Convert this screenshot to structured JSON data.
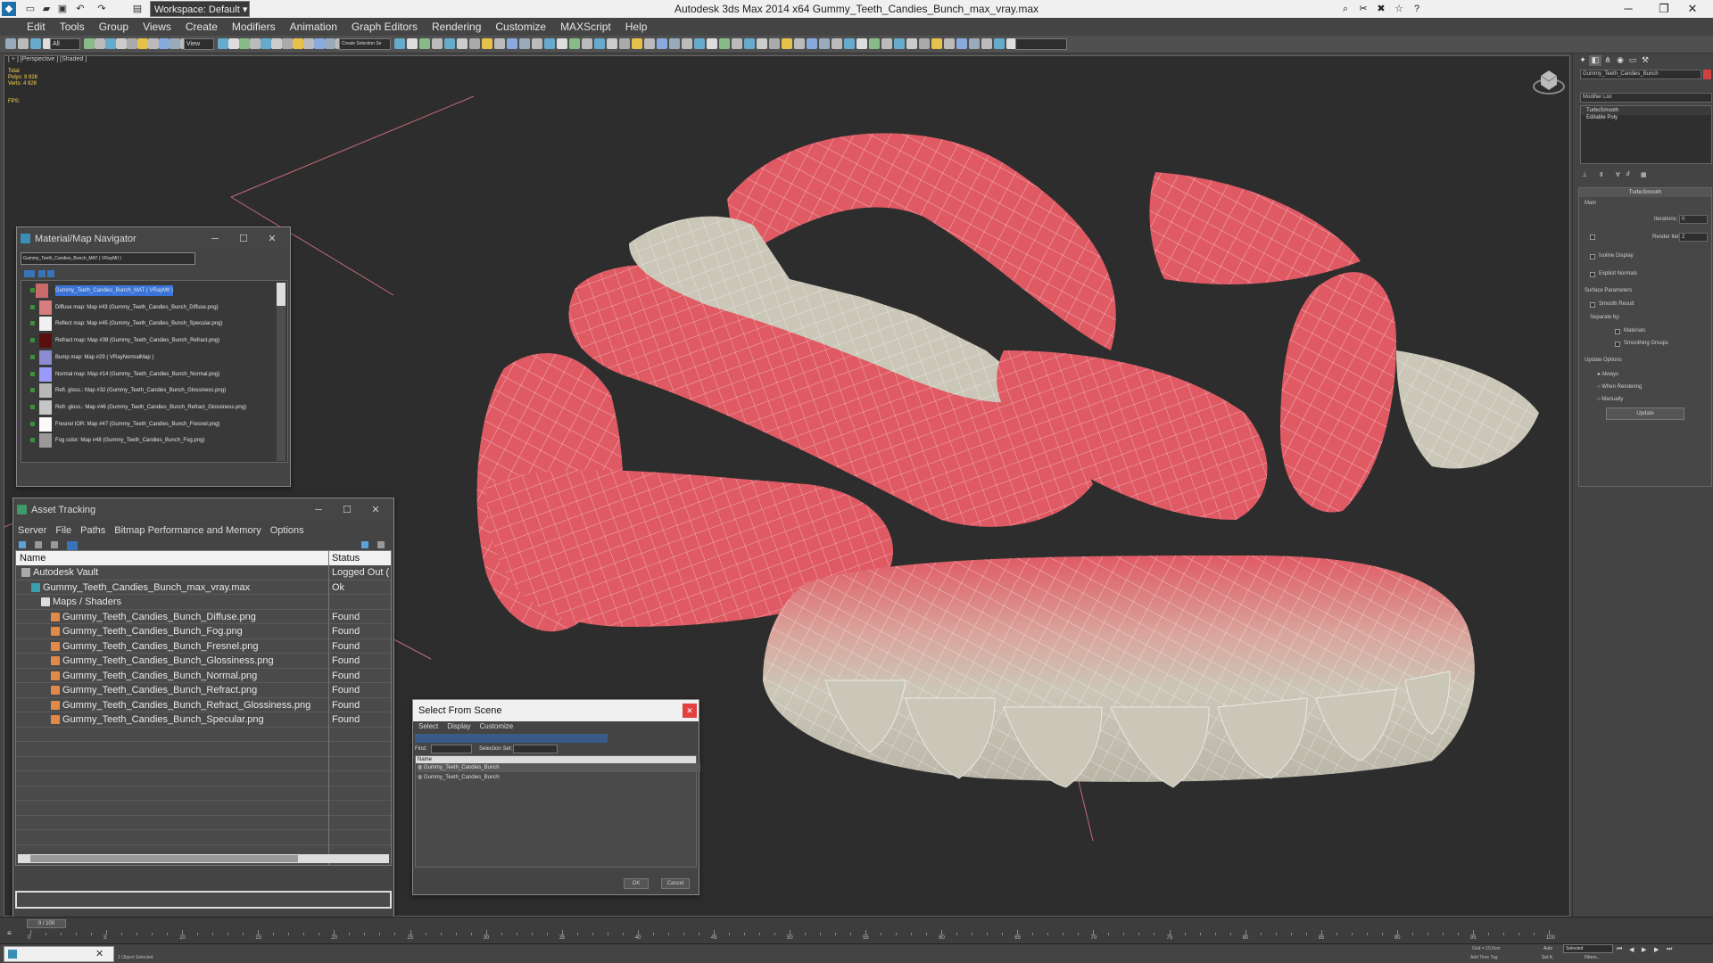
{
  "titlebar": {
    "title": "Autodesk 3ds Max  2014 x64    Gummy_Teeth_Candies_Bunch_max_vray.max",
    "workspace": "Workspace: Default",
    "minimize": "─",
    "restore": "❐",
    "close": "✕"
  },
  "menu": [
    "Edit",
    "Tools",
    "Group",
    "Views",
    "Create",
    "Modifiers",
    "Animation",
    "Graph Editors",
    "Rendering",
    "Customize",
    "MAXScript",
    "Help"
  ],
  "toolbar": {
    "selection_filter": "All",
    "ref_coord": "View",
    "named_selection": "Create Selection Se"
  },
  "viewport": {
    "label": "[ + ] [Perspective ] [Shaded ]",
    "stats_total": "Total",
    "stats_polys": "Polys:  9 828",
    "stats_verts": "Verts:  4 928",
    "fps": "FPS:"
  },
  "command_panel": {
    "object_name": "Gummy_Teeth_Candies_Bunch",
    "modifier_list": "Modifier List",
    "stack": [
      "TurboSmooth",
      "Editable Poly"
    ],
    "turbosmooth_title": "TurboSmooth",
    "main_label": "Main",
    "iterations_label": "Iterations:",
    "iterations_value": "0",
    "render_iters_label": "Render Iters:",
    "render_iters_value": "2",
    "isoline_display": "Isoline Display",
    "explicit_normals": "Explicit Normals",
    "surface_params": "Surface Parameters",
    "smooth_result": "Smooth Result",
    "separate_by": "Separate by:",
    "materials": "Materials",
    "smoothing_groups": "Smoothing Groups",
    "update_options": "Update Options",
    "always": "Always",
    "when_rendering": "When Rendering",
    "manually": "Manually",
    "update": "Update"
  },
  "material_navigator": {
    "title": "Material/Map Navigator",
    "field": "Gummy_Teeth_Candies_Bunch_MAT  ( VRayMtl )",
    "items": [
      {
        "label": "Gummy_Teeth_Candies_Bunch_MAT  ( VRayMtl )",
        "color": "#c86a6a",
        "selected": true
      },
      {
        "label": "Diffuse map: Map #43 (Gummy_Teeth_Candies_Bunch_Diffuse.png)",
        "color": "#d77d7d"
      },
      {
        "label": "Reflect map: Map #45 (Gummy_Teeth_Candies_Bunch_Specular.png)",
        "color": "#f0f0f0"
      },
      {
        "label": "Refract map: Map #39 (Gummy_Teeth_Candies_Bunch_Refract.png)",
        "color": "#5a0f0f"
      },
      {
        "label": "Bump map: Map #29  ( VRayNormalMap )",
        "color": "#8c8cd2"
      },
      {
        "label": "Normal map: Map #14 (Gummy_Teeth_Candies_Bunch_Normal.png)",
        "color": "#9a9aff"
      },
      {
        "label": "Refl. gloss.: Map #32 (Gummy_Teeth_Candies_Bunch_Glossiness.png)",
        "color": "#b8b8b8"
      },
      {
        "label": "Refr. gloss.: Map #46 (Gummy_Teeth_Candies_Bunch_Refract_Glossiness.png)",
        "color": "#c6c6c6"
      },
      {
        "label": "Fresnel IOR: Map #47 (Gummy_Teeth_Candies_Bunch_Fresnel.png)",
        "color": "#fafafa"
      },
      {
        "label": "Fog color: Map #48 (Gummy_Teeth_Candies_Bunch_Fog.png)",
        "color": "#9a9a9a"
      }
    ]
  },
  "asset_tracking": {
    "title": "Asset Tracking",
    "menu": [
      "Server",
      "File",
      "Paths",
      "Bitmap Performance and Memory",
      "Options"
    ],
    "col_name": "Name",
    "col_status": "Status",
    "rows": [
      {
        "name": "Autodesk Vault",
        "status": "Logged Out (",
        "indent": 0,
        "icon": "vault"
      },
      {
        "name": "Gummy_Teeth_Candies_Bunch_max_vray.max",
        "status": "Ok",
        "indent": 1,
        "icon": "max"
      },
      {
        "name": "Maps / Shaders",
        "status": "",
        "indent": 2,
        "icon": "folder"
      },
      {
        "name": "Gummy_Teeth_Candies_Bunch_Diffuse.png",
        "status": "Found",
        "indent": 3,
        "icon": "image"
      },
      {
        "name": "Gummy_Teeth_Candies_Bunch_Fog.png",
        "status": "Found",
        "indent": 3,
        "icon": "image"
      },
      {
        "name": "Gummy_Teeth_Candies_Bunch_Fresnel.png",
        "status": "Found",
        "indent": 3,
        "icon": "image"
      },
      {
        "name": "Gummy_Teeth_Candies_Bunch_Glossiness.png",
        "status": "Found",
        "indent": 3,
        "icon": "image"
      },
      {
        "name": "Gummy_Teeth_Candies_Bunch_Normal.png",
        "status": "Found",
        "indent": 3,
        "icon": "image"
      },
      {
        "name": "Gummy_Teeth_Candies_Bunch_Refract.png",
        "status": "Found",
        "indent": 3,
        "icon": "image"
      },
      {
        "name": "Gummy_Teeth_Candies_Bunch_Refract_Glossiness.png",
        "status": "Found",
        "indent": 3,
        "icon": "image"
      },
      {
        "name": "Gummy_Teeth_Candies_Bunch_Specular.png",
        "status": "Found",
        "indent": 3,
        "icon": "image"
      }
    ]
  },
  "select_from_scene": {
    "title": "Select From Scene",
    "menu": [
      "Select",
      "Display",
      "Customize"
    ],
    "find_label": "Find:",
    "selection_set": "Selection Set:",
    "col_name": "Name",
    "rows": [
      "Gummy_Teeth_Candies_Bunch",
      "Gummy_Teeth_Candies_Bunch"
    ],
    "ok": "OK",
    "cancel": "Cancel"
  },
  "timeline": {
    "frame": "0 / 100",
    "ticks": [
      "0",
      "5",
      "10",
      "15",
      "20",
      "25",
      "30",
      "35",
      "40",
      "45",
      "50",
      "55",
      "60",
      "65",
      "70",
      "75",
      "80",
      "85",
      "90",
      "95",
      "100"
    ]
  },
  "statusbar": {
    "message": "1 Object Selected",
    "grid": "Grid = 10,0cm",
    "auto_key": "Auto",
    "set_key": "Set K.",
    "selected": "Selected",
    "filters": "Filters...",
    "add_time_tag": "Add Time Tag"
  },
  "colors": {
    "gum": "#e05a64",
    "tooth": "#cbc7b8",
    "viewport_bg": "#2d2d2d"
  }
}
